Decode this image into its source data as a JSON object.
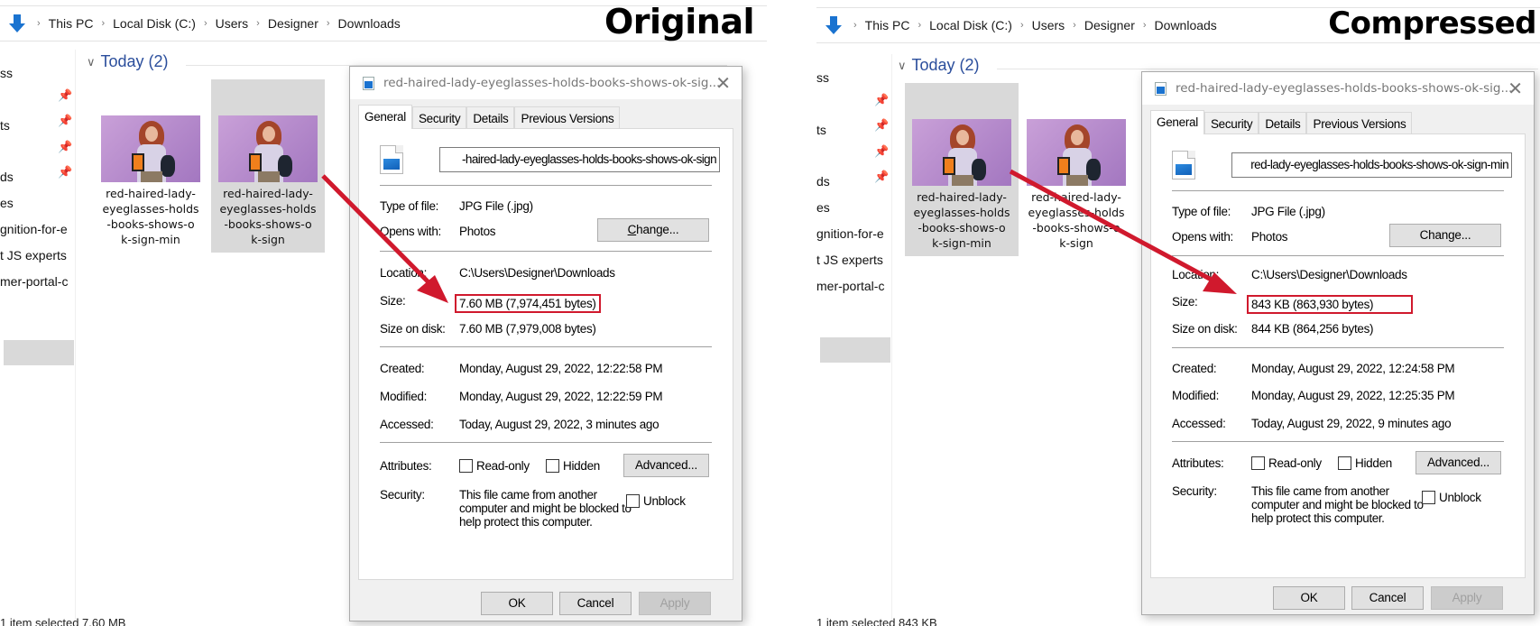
{
  "panels": [
    {
      "heading": "Original",
      "breadcrumb": [
        "This PC",
        "Local Disk (C:)",
        "Users",
        "Designer",
        "Downloads"
      ],
      "sidebar_items": [
        "ss",
        "",
        "ts",
        "",
        "ds",
        "es",
        "gnition-for-e",
        "t JS experts",
        "mer-portal-c"
      ],
      "group_label": "Today (2)",
      "files": [
        {
          "name": "red-haired-lady-eyeglasses-holds-books-shows-ok-sign-min",
          "caption": [
            "red-haired-lady-",
            "eyeglasses-holds",
            "-books-shows-o",
            "k-sign-min"
          ],
          "selected": false
        },
        {
          "name": "red-haired-lady-eyeglasses-holds-books-shows-ok-sign",
          "caption": [
            "red-haired-lady-",
            "eyeglasses-holds",
            "-books-shows-o",
            "k-sign"
          ],
          "selected": true
        }
      ],
      "status": "1 item selected  7.60 MB",
      "dialog": {
        "title": "red-haired-lady-eyeglasses-holds-books-shows-ok-sig...",
        "tabs": [
          "General",
          "Security",
          "Details",
          "Previous Versions"
        ],
        "active_tab": "General",
        "filename_value": "-haired-lady-eyeglasses-holds-books-shows-ok-sign",
        "type_label": "Type of file:",
        "type_value": "JPG File (.jpg)",
        "opens_label": "Opens with:",
        "opens_value": "Photos",
        "change_button": "Change...",
        "location_label": "Location:",
        "location_value": "C:\\Users\\Designer\\Downloads",
        "size_label": "Size:",
        "size_value": "7.60 MB (7,974,451 bytes)",
        "size_on_disk_label": "Size on disk:",
        "size_on_disk_value": "7.60 MB (7,979,008 bytes)",
        "created_label": "Created:",
        "created_value": "Monday, August 29, 2022, 12:22:58 PM",
        "modified_label": "Modified:",
        "modified_value": "Monday, August 29, 2022, 12:22:59 PM",
        "accessed_label": "Accessed:",
        "accessed_value": "Today, August 29, 2022, 3 minutes ago",
        "attributes_label": "Attributes:",
        "readonly_label": "Read-only",
        "hidden_label": "Hidden",
        "advanced_button": "Advanced...",
        "security_label": "Security:",
        "security_text": "This file came from another computer and might be blocked to help protect this computer.",
        "unblock_label": "Unblock",
        "ok_button": "OK",
        "cancel_button": "Cancel",
        "apply_button": "Apply"
      }
    },
    {
      "heading": "Compressed",
      "breadcrumb": [
        "This PC",
        "Local Disk (C:)",
        "Users",
        "Designer",
        "Downloads"
      ],
      "sidebar_items": [
        "ss",
        "",
        "ts",
        "",
        "ds",
        "es",
        "gnition-for-e",
        "t JS experts",
        "mer-portal-c"
      ],
      "group_label": "Today (2)",
      "files": [
        {
          "name": "red-haired-lady-eyeglasses-holds-books-shows-ok-sign-min",
          "caption": [
            "red-haired-lady-",
            "eyeglasses-holds",
            "-books-shows-o",
            "k-sign-min"
          ],
          "selected": true
        },
        {
          "name": "red-haired-lady-eyeglasses-holds-books-shows-ok-sign",
          "caption": [
            "red-haired-lady-",
            "eyeglasses-holds",
            "-books-shows-o",
            "k-sign"
          ],
          "selected": false
        }
      ],
      "status": "1 item selected  843 KB",
      "dialog": {
        "title": "red-haired-lady-eyeglasses-holds-books-shows-ok-sig...",
        "tabs": [
          "General",
          "Security",
          "Details",
          "Previous Versions"
        ],
        "active_tab": "General",
        "filename_value": "red-lady-eyeglasses-holds-books-shows-ok-sign-min",
        "type_label": "Type of file:",
        "type_value": "JPG File (.jpg)",
        "opens_label": "Opens with:",
        "opens_value": "Photos",
        "change_button": "Change...",
        "location_label": "Location:",
        "location_value": "C:\\Users\\Designer\\Downloads",
        "size_label": "Size:",
        "size_value": "843 KB (863,930 bytes)",
        "size_on_disk_label": "Size on disk:",
        "size_on_disk_value": "844 KB (864,256 bytes)",
        "created_label": "Created:",
        "created_value": "Monday, August 29, 2022, 12:24:58 PM",
        "modified_label": "Modified:",
        "modified_value": "Monday, August 29, 2022, 12:25:35 PM",
        "accessed_label": "Accessed:",
        "accessed_value": "Today, August 29, 2022, 9 minutes ago",
        "attributes_label": "Attributes:",
        "readonly_label": "Read-only",
        "hidden_label": "Hidden",
        "advanced_button": "Advanced...",
        "security_label": "Security:",
        "security_text": "This file came from another computer and might be blocked to help protect this computer.",
        "unblock_label": "Unblock",
        "ok_button": "OK",
        "cancel_button": "Cancel",
        "apply_button": "Apply"
      }
    }
  ],
  "colors": {
    "highlight_box": "#d0192d",
    "arrow": "#d0192d",
    "group_label": "#2b4e9c",
    "download_icon": "#1a73d0"
  }
}
